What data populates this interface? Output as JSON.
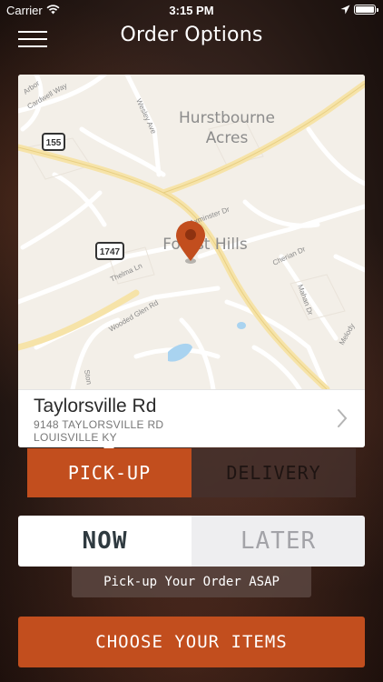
{
  "status_bar": {
    "carrier": "Carrier",
    "time": "3:15 PM"
  },
  "header": {
    "title": "Order Options",
    "menu_icon": "hamburger-menu-icon"
  },
  "map": {
    "area_labels": [
      "Hurstbourne",
      "Acres",
      "Forest Hills"
    ],
    "street_labels": [
      "Arbor",
      "Cardwell Way",
      "Wesley Ave",
      "Axminster Dr",
      "Cherian Dr",
      "Thelma Ln",
      "Wooded Glen Rd",
      "Mahan Dr",
      "Melody",
      "Ston"
    ],
    "route_shields": [
      "155",
      "1747"
    ],
    "pin_icon": "map-pin-icon",
    "pin_color": "#c24e1e"
  },
  "location": {
    "street": "Taylorsville Rd",
    "address_line1": "9148 TAYLORSVILLE RD",
    "address_line2": "LOUISVILLE KY"
  },
  "order_mode": {
    "pickup_label": "PICK-UP",
    "delivery_label": "DELIVERY",
    "selected": "PICK-UP"
  },
  "order_time": {
    "now_label": "NOW",
    "later_label": "LATER",
    "selected": "NOW",
    "hint": "Pick-up Your Order ASAP"
  },
  "cta": {
    "label": "CHOOSE YOUR ITEMS"
  },
  "colors": {
    "accent": "#c24e1e",
    "map_background": "#f3efe8",
    "major_road": "#f6e3a8"
  }
}
